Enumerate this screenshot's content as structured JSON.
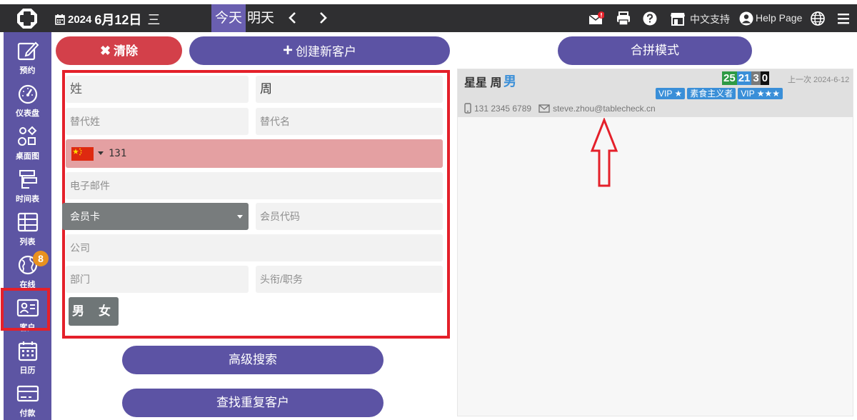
{
  "topbar": {
    "year": "2024",
    "month_day": "6月12日",
    "weekday": "三",
    "today": "今天",
    "tomorrow": "明天",
    "prev": "‹",
    "next": "›",
    "language": "中文支持",
    "help": "Help Page"
  },
  "sidebar": {
    "items": [
      {
        "label": "预约",
        "icon": "edit-icon"
      },
      {
        "label": "仪表盘",
        "icon": "gauge-icon"
      },
      {
        "label": "桌面图",
        "icon": "shapes-icon"
      },
      {
        "label": "时间表",
        "icon": "timeline-icon"
      },
      {
        "label": "列表",
        "icon": "table-icon"
      },
      {
        "label": "在线",
        "icon": "globe-icon",
        "badge": "8"
      },
      {
        "label": "客户",
        "icon": "id-card-icon",
        "selected": true
      },
      {
        "label": "日历",
        "icon": "calendar-icon"
      },
      {
        "label": "付款",
        "icon": "credit-card-icon"
      }
    ]
  },
  "actions": {
    "clear": "清除",
    "create": "创建新客户",
    "merge": "合拼模式",
    "advanced_search": "高级搜索",
    "find_duplicates": "查找重复客户"
  },
  "form": {
    "last_name_placeholder": "姓",
    "first_name_value": "周",
    "alt_last_name_placeholder": "替代姓",
    "alt_first_name_placeholder": "替代名",
    "phone_value": "131",
    "email_placeholder": "电子邮件",
    "member_card": "会员卡",
    "member_code_placeholder": "会员代码",
    "company_placeholder": "公司",
    "department_placeholder": "部门",
    "title_placeholder": "头衔/职务",
    "male": "男",
    "female": "女"
  },
  "result": {
    "name": "星星 周",
    "sex": "男",
    "counts": [
      {
        "value": "25",
        "color": "#2e9a45"
      },
      {
        "value": "21",
        "color": "#3a8fd8"
      },
      {
        "value": "3",
        "color": "#7a7a7a"
      },
      {
        "value": "0",
        "color": "#111111"
      }
    ],
    "last_visit": "上一次 2024-6-12",
    "tags": [
      "VIP ★",
      "素食主义者",
      "VIP ★★★"
    ],
    "phone": "131 2345 6789",
    "email": "steve.zhou@tablecheck.cn"
  },
  "colors": {
    "topbar": "#2f2f31",
    "sidebar": "#5d55a3",
    "primary": "#5c53a4",
    "danger": "#d3404a",
    "highlight": "#e4202a"
  }
}
